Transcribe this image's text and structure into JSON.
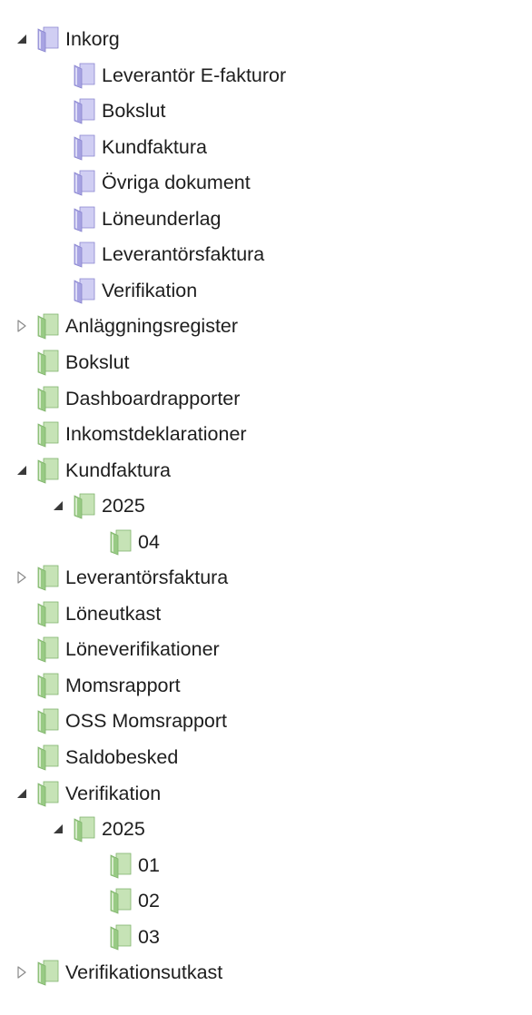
{
  "tree": {
    "nodes": [
      {
        "id": "inkorg",
        "label": "Inkorg",
        "level": 0,
        "toggle": "expanded",
        "color": "purple"
      },
      {
        "id": "inkorg-leverantor-e-fakturor",
        "label": "Leverantör E-fakturor",
        "level": 1,
        "toggle": "none",
        "color": "purple"
      },
      {
        "id": "inkorg-bokslut",
        "label": "Bokslut",
        "level": 1,
        "toggle": "none",
        "color": "purple"
      },
      {
        "id": "inkorg-kundfaktura",
        "label": "Kundfaktura",
        "level": 1,
        "toggle": "none",
        "color": "purple"
      },
      {
        "id": "inkorg-ovriga-dokument",
        "label": "Övriga dokument",
        "level": 1,
        "toggle": "none",
        "color": "purple"
      },
      {
        "id": "inkorg-loneunderlag",
        "label": "Löneunderlag",
        "level": 1,
        "toggle": "none",
        "color": "purple"
      },
      {
        "id": "inkorg-leverantorsfaktura",
        "label": "Leverantörsfaktura",
        "level": 1,
        "toggle": "none",
        "color": "purple"
      },
      {
        "id": "inkorg-verifikation",
        "label": "Verifikation",
        "level": 1,
        "toggle": "none",
        "color": "purple"
      },
      {
        "id": "anlaggningsregister",
        "label": "Anläggningsregister",
        "level": 0,
        "toggle": "collapsed",
        "color": "green"
      },
      {
        "id": "bokslut",
        "label": "Bokslut",
        "level": 0,
        "toggle": "none",
        "color": "green"
      },
      {
        "id": "dashboardrapporter",
        "label": "Dashboardrapporter",
        "level": 0,
        "toggle": "none",
        "color": "green"
      },
      {
        "id": "inkomstdeklarationer",
        "label": "Inkomstdeklarationer",
        "level": 0,
        "toggle": "none",
        "color": "green"
      },
      {
        "id": "kundfaktura",
        "label": "Kundfaktura",
        "level": 0,
        "toggle": "expanded",
        "color": "green"
      },
      {
        "id": "kundfaktura-2025",
        "label": "2025",
        "level": 1,
        "toggle": "expanded",
        "color": "green"
      },
      {
        "id": "kundfaktura-2025-04",
        "label": "04",
        "level": 2,
        "toggle": "none",
        "color": "green"
      },
      {
        "id": "leverantorsfaktura",
        "label": "Leverantörsfaktura",
        "level": 0,
        "toggle": "collapsed",
        "color": "green"
      },
      {
        "id": "loneutkast",
        "label": "Löneutkast",
        "level": 0,
        "toggle": "none",
        "color": "green"
      },
      {
        "id": "loneverifikationer",
        "label": "Löneverifikationer",
        "level": 0,
        "toggle": "none",
        "color": "green"
      },
      {
        "id": "momsrapport",
        "label": "Momsrapport",
        "level": 0,
        "toggle": "none",
        "color": "green"
      },
      {
        "id": "oss-momsrapport",
        "label": "OSS Momsrapport",
        "level": 0,
        "toggle": "none",
        "color": "green"
      },
      {
        "id": "saldobesked",
        "label": "Saldobesked",
        "level": 0,
        "toggle": "none",
        "color": "green"
      },
      {
        "id": "verifikation",
        "label": "Verifikation",
        "level": 0,
        "toggle": "expanded",
        "color": "green"
      },
      {
        "id": "verifikation-2025",
        "label": "2025",
        "level": 1,
        "toggle": "expanded",
        "color": "green"
      },
      {
        "id": "verifikation-2025-01",
        "label": "01",
        "level": 2,
        "toggle": "none",
        "color": "green"
      },
      {
        "id": "verifikation-2025-02",
        "label": "02",
        "level": 2,
        "toggle": "none",
        "color": "green"
      },
      {
        "id": "verifikation-2025-03",
        "label": "03",
        "level": 2,
        "toggle": "none",
        "color": "green"
      },
      {
        "id": "verifikationsutkast",
        "label": "Verifikationsutkast",
        "level": 0,
        "toggle": "collapsed",
        "color": "green"
      }
    ]
  },
  "icons": {
    "folder": "folder-icon",
    "expanded": "expanded-triangle-icon",
    "collapsed": "collapsed-triangle-icon"
  },
  "colors": {
    "purple": {
      "front": "#a7a3e2",
      "back": "#d0cef3",
      "edge": "#8985cf",
      "light": "#ecebfb"
    },
    "green": {
      "front": "#98ca84",
      "back": "#c6e3b6",
      "edge": "#7fb36b",
      "light": "#e8f4e0"
    },
    "text": "#1e1e1e",
    "toggle_expanded": "#3a3a3a",
    "toggle_collapsed": "#8a8a8a"
  }
}
